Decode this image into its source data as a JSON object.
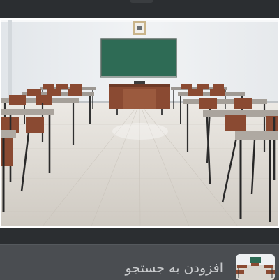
{
  "viewer": {
    "image_subject": "classroom-photo"
  },
  "suggestion": {
    "label": "افزودن به جستجو"
  },
  "colors": {
    "background": "#2b2e31",
    "suggestion_bar": "#4a4d51",
    "label_text": "#c8cacc",
    "chalkboard": "#2e6b55",
    "desk_wood": "#8a4a32",
    "floor": "#d8d4cd"
  }
}
